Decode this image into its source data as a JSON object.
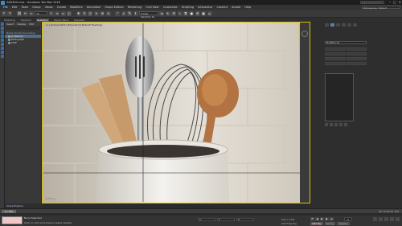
{
  "window": {
    "title": "SAD3DS.max - Autodesk 3ds Max 2018",
    "search_placeholder": "Type a keyword or phrase",
    "controls": [
      "–",
      "□",
      "×"
    ]
  },
  "menu": [
    "File",
    "Edit",
    "Tools",
    "Group",
    "Views",
    "Create",
    "Modifiers",
    "Animation",
    "Graph Editors",
    "Rendering",
    "Civil View",
    "Customize",
    "Scripting",
    "Interactive",
    "Content",
    "Arnold",
    "Help"
  ],
  "workspace": "Workspaces: Default",
  "toolbar": {
    "selection_filter": "All",
    "create_selection_set": "Create Selection Se"
  },
  "ribbon": {
    "tabs": [
      "Modeling",
      "Freeform",
      "Selection",
      "Object Paint",
      "Populate"
    ],
    "active": "Selection"
  },
  "scene_explorer": {
    "menu": [
      "Select",
      "Display",
      "Edit"
    ],
    "header": "Name (Sorted Ascending)",
    "rows": [
      {
        "label": "0 (default)",
        "selected": true
      },
      {
        "label": "Photograph",
        "selected": false
      },
      {
        "label": "Stuff",
        "selected": false
      }
    ],
    "footer": "Scene Explorer"
  },
  "viewport": {
    "label": "[+] [Camera001] [Standard] [Default Shading]",
    "axis": "y ↑ x →"
  },
  "command_panel": {
    "rows": [
      [
        "",
        ""
      ],
      [
        "",
        ""
      ],
      [
        "",
        ""
      ],
      [
        "",
        ""
      ]
    ],
    "dropdown": "Modifier List"
  },
  "timeslider": {
    "handle": "0 / 100",
    "right_label": "60 70 80 90 100"
  },
  "status": {
    "selected": "None Selected",
    "prompt": "Click or click-and-drag to select objects",
    "coords": [
      "X:",
      "Y:",
      "Z:"
    ],
    "grid": "Grid = 10.0",
    "add_time_tag": "Add Time Tag",
    "frame": "0",
    "auto_key": "Auto Key",
    "set_key": "Set Key",
    "selected_mode": "Selected"
  }
}
